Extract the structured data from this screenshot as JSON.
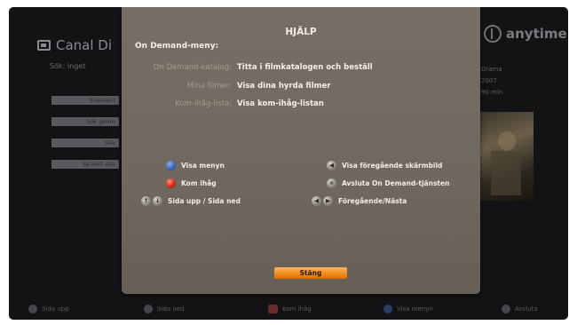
{
  "background": {
    "brand": "Canal Di",
    "search_text": "Sök: Inget",
    "menu_items": [
      "Standard",
      "Sök genre",
      "Sök",
      "Se bort alla"
    ],
    "anytime_logo": "anytime",
    "info_lines": [
      "Drama",
      "2007",
      "90 min"
    ],
    "bottom_bar": [
      {
        "label": "Sida upp",
        "icon": "gray-key-icon"
      },
      {
        "label": "Sida ned",
        "icon": "gray-key-icon"
      },
      {
        "label": "Kom ihåg",
        "icon": "red-key-icon"
      },
      {
        "label": "Visa menyn",
        "icon": "blue-key-icon"
      },
      {
        "label": "Avsluta",
        "icon": "gray-key-icon"
      }
    ]
  },
  "dialog": {
    "title": "HJÄLP",
    "subtitle": "On Demand-meny:",
    "rows": [
      {
        "label": "On Demand-katalog:",
        "value": "Titta i filmkatalogen och beställ"
      },
      {
        "label": "Mina filmer:",
        "value": "Visa dina hyrda filmer"
      },
      {
        "label": "Kom-ihåg-lista:",
        "value": "Visa kom-ihåg-listan"
      }
    ],
    "legend_left": [
      {
        "label": "Visa menyn",
        "icon": "blue-key-icon"
      },
      {
        "label": "Kom ihåg",
        "icon": "red-key-icon"
      },
      {
        "label": "Sida upp / Sida ned",
        "icon": "page-keys-icon"
      }
    ],
    "legend_right": [
      {
        "label": "Visa föregående skärmbild",
        "icon": "back-key-icon"
      },
      {
        "label": "Avsluta On Demand-tjänsten",
        "icon": "exit-key-icon"
      },
      {
        "label": "Föregående/Nästa",
        "icon": "prev-next-keys-icon"
      }
    ],
    "close_label": "Stäng"
  },
  "colors": {
    "dialog_bg": "#736b61",
    "accent_orange": "#f08a1a",
    "blue_key": "#3d66b8",
    "red_key": "#d32a1c"
  }
}
